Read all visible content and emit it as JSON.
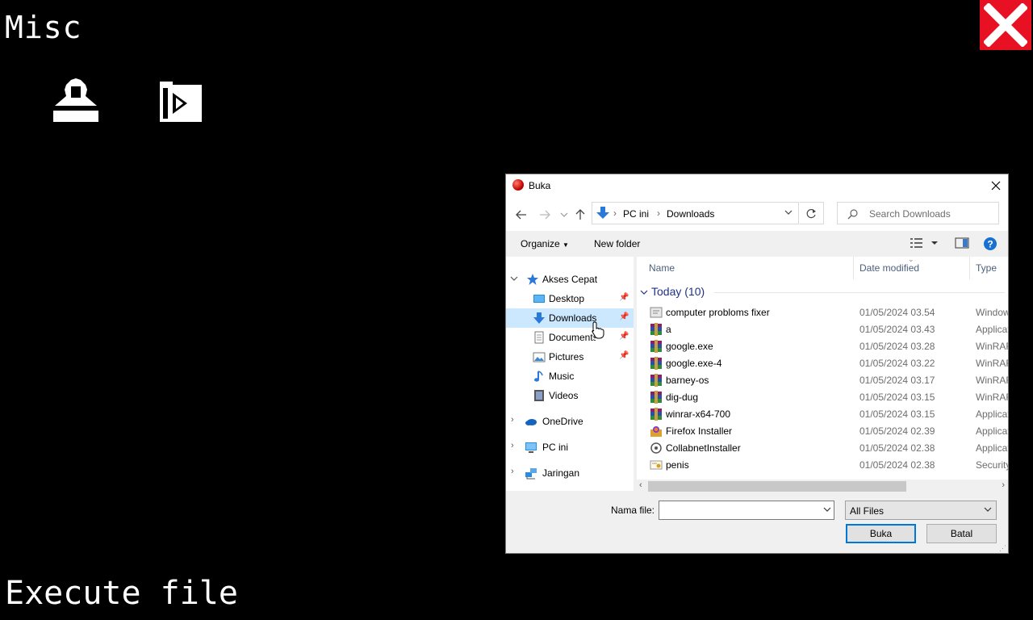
{
  "app": {
    "title": "Misc",
    "footer": "Execute file"
  },
  "dialog": {
    "title": "Buka",
    "address": {
      "crumbs": [
        "PC ini",
        "Downloads"
      ]
    },
    "search_placeholder": "Search Downloads",
    "toolbar": {
      "organize": "Organize",
      "new_folder": "New folder"
    },
    "sidebar": {
      "quick_access": "Akses Cepat",
      "items": [
        "Desktop",
        "Downloads",
        "Documents",
        "Pictures",
        "Music",
        "Videos"
      ],
      "onedrive": "OneDrive",
      "this_pc": "PC ini",
      "network": "Jaringan",
      "selected": "Downloads"
    },
    "columns": {
      "name": "Name",
      "date": "Date modified",
      "type": "Type"
    },
    "group": "Today (10)",
    "files": [
      {
        "name": "computer probloms fixer",
        "date": "01/05/2024 03.54",
        "type": "Windows",
        "icon": "script-icon"
      },
      {
        "name": "a",
        "date": "01/05/2024 03.43",
        "type": "Application",
        "icon": "winrar-icon"
      },
      {
        "name": "google.exe",
        "date": "01/05/2024 03.28",
        "type": "WinRAR",
        "icon": "winrar-icon"
      },
      {
        "name": "google.exe-4",
        "date": "01/05/2024 03.22",
        "type": "WinRAR",
        "icon": "winrar-icon"
      },
      {
        "name": "barney-os",
        "date": "01/05/2024 03.17",
        "type": "WinRAR",
        "icon": "winrar-icon"
      },
      {
        "name": "dig-dug",
        "date": "01/05/2024 03.15",
        "type": "WinRAR",
        "icon": "winrar-icon"
      },
      {
        "name": "winrar-x64-700",
        "date": "01/05/2024 03.15",
        "type": "Application",
        "icon": "winrar-icon"
      },
      {
        "name": "Firefox Installer",
        "date": "01/05/2024 02.39",
        "type": "Application",
        "icon": "firefox-icon"
      },
      {
        "name": "CollabnetInstaller",
        "date": "01/05/2024 02.38",
        "type": "Application",
        "icon": "installer-icon"
      },
      {
        "name": "penis",
        "date": "01/05/2024 02.38",
        "type": "Security",
        "icon": "certificate-icon"
      }
    ],
    "filename_label": "Nama file:",
    "filename_value": "",
    "filter": "All Files",
    "open_button": "Buka",
    "cancel_button": "Batal"
  },
  "colors": {
    "close_red": "#e81123",
    "selected_bg": "#cce8ff",
    "accent": "#0078d7",
    "group_text": "#1e3287"
  }
}
